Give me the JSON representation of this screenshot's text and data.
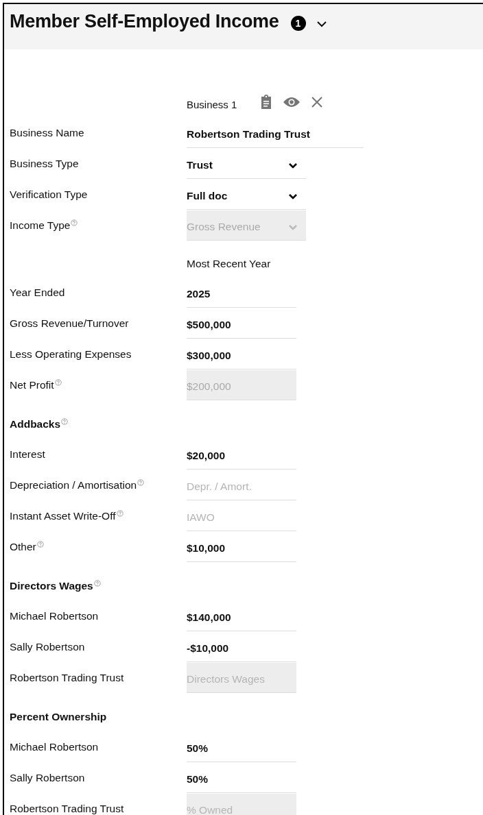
{
  "section": {
    "title": "Member Self-Employed Income",
    "badge": "1",
    "expanded": true
  },
  "business": {
    "label": "Business 1"
  },
  "rows": [
    {
      "kind": "text",
      "label": "Business Name",
      "help": false,
      "value": "Robertson Trading Trust",
      "disabled": false
    },
    {
      "kind": "select",
      "label": "Business Type",
      "help": false,
      "value": "Trust",
      "disabled": false
    },
    {
      "kind": "select",
      "label": "Verification Type",
      "help": false,
      "value": "Full doc",
      "disabled": false
    },
    {
      "kind": "select",
      "label": "Income Type",
      "help": true,
      "value": "Gross Revenue",
      "disabled": true
    },
    {
      "kind": "column-heading",
      "label": "Most Recent Year"
    },
    {
      "kind": "amount",
      "label": "Year Ended",
      "help": false,
      "value": "2025",
      "disabled": false
    },
    {
      "kind": "amount",
      "label": "Gross Revenue/Turnover",
      "help": false,
      "value": "$500,000",
      "disabled": false
    },
    {
      "kind": "amount",
      "label": "Less Operating Expenses",
      "help": false,
      "value": "$300,000",
      "disabled": false
    },
    {
      "kind": "amount",
      "label": "Net Profit",
      "help": true,
      "value": "$200,000",
      "disabled": true
    },
    {
      "kind": "section",
      "label": "Addbacks",
      "help": true
    },
    {
      "kind": "amount",
      "label": "Interest",
      "help": false,
      "value": "$20,000",
      "disabled": false
    },
    {
      "kind": "amount",
      "label": "Depreciation / Amortisation",
      "help": true,
      "placeholder": "Depr. / Amort.",
      "disabled": false
    },
    {
      "kind": "amount",
      "label": "Instant Asset Write-Off",
      "help": true,
      "placeholder": "IAWO",
      "disabled": false
    },
    {
      "kind": "amount",
      "label": "Other",
      "help": true,
      "value": "$10,000",
      "disabled": false
    },
    {
      "kind": "section",
      "label": "Directors Wages",
      "help": true
    },
    {
      "kind": "amount",
      "label": "Michael Robertson",
      "help": false,
      "value": "$140,000",
      "disabled": false
    },
    {
      "kind": "amount",
      "label": "Sally Robertson",
      "help": false,
      "value": "-$10,000",
      "disabled": false
    },
    {
      "kind": "amount",
      "label": "Robertson Trading Trust",
      "help": false,
      "placeholder": "Directors Wages",
      "disabled": true
    },
    {
      "kind": "section",
      "label": "Percent Ownership",
      "help": false
    },
    {
      "kind": "amount",
      "label": "Michael Robertson",
      "help": false,
      "value": "50%",
      "disabled": false
    },
    {
      "kind": "amount",
      "label": "Sally Robertson",
      "help": false,
      "value": "50%",
      "disabled": false
    },
    {
      "kind": "amount",
      "label": "Robertson Trading Trust",
      "help": false,
      "placeholder": "% Owned",
      "disabled": true
    }
  ]
}
